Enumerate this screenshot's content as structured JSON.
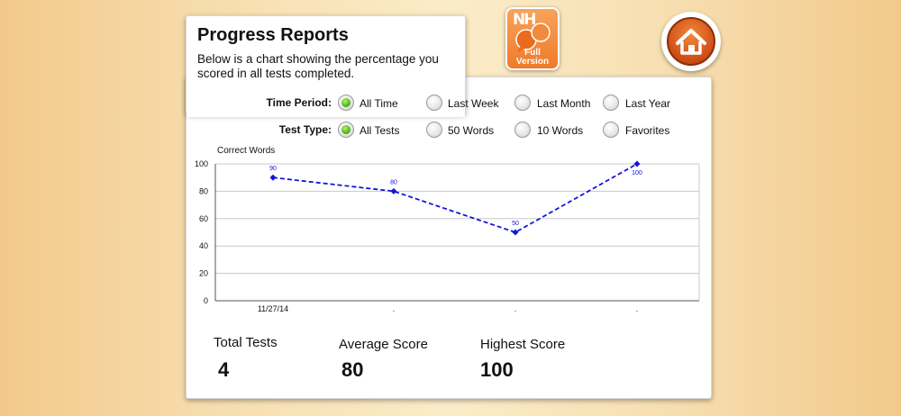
{
  "header": {
    "title": "Progress Reports",
    "description": "Below is a chart showing the percentage you scored in all tests completed."
  },
  "badge": {
    "logo": "NH",
    "line1": "Full",
    "line2": "Version",
    "icon": "speech-bubbles-icon"
  },
  "home_button": {
    "icon": "home-icon"
  },
  "filters": {
    "time_period": {
      "label": "Time Period:",
      "options": [
        "All Time",
        "Last Week",
        "Last Month",
        "Last Year"
      ],
      "selected": "All Time"
    },
    "test_type": {
      "label": "Test Type:",
      "options": [
        "All Tests",
        "50 Words",
        "10 Words",
        "Favorites"
      ],
      "selected": "All Tests"
    }
  },
  "chart_data": {
    "type": "line",
    "ylabel": "Correct Words",
    "xlabel": "",
    "ylim": [
      0,
      100
    ],
    "yticks": [
      0,
      20,
      40,
      60,
      80,
      100
    ],
    "categories": [
      "11/27/14",
      ".",
      ".",
      "."
    ],
    "series": [
      {
        "values": [
          90,
          80,
          50,
          100
        ],
        "color": "#1515d8"
      }
    ],
    "data_labels": [
      "90",
      "80",
      "50",
      "100"
    ],
    "grid": true
  },
  "stats": {
    "total_tests": {
      "label": "Total Tests",
      "value": "4"
    },
    "average_score": {
      "label": "Average Score",
      "value": "80"
    },
    "highest_score": {
      "label": "Highest Score",
      "value": "100"
    }
  },
  "colors": {
    "accent": "#ef7a2a",
    "line": "#1515d8",
    "radio_on": "#4fb51e"
  }
}
